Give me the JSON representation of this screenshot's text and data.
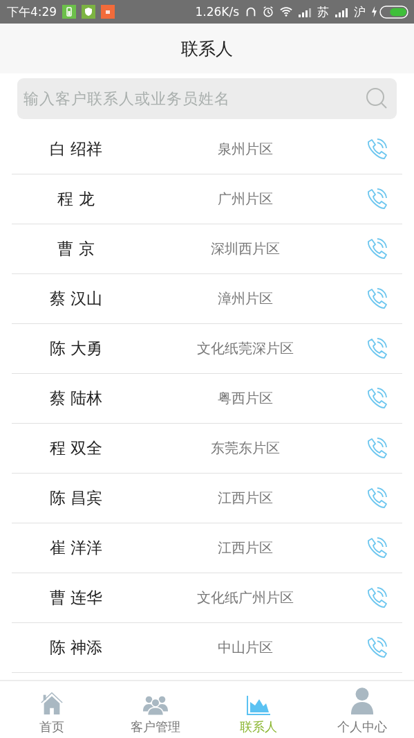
{
  "status_bar": {
    "time": "下午4:29",
    "speed": "1.26K/s",
    "sim_1": "苏",
    "sim_2": "沪"
  },
  "header": {
    "title": "联系人"
  },
  "search": {
    "placeholder": "输入客户联系人或业务员姓名"
  },
  "contacts": [
    {
      "name": "白 绍祥",
      "region": "泉州片区"
    },
    {
      "name": "程 龙",
      "region": "广州片区"
    },
    {
      "name": "曹 京",
      "region": "深圳西片区"
    },
    {
      "name": "蔡 汉山",
      "region": "漳州片区"
    },
    {
      "name": "陈 大勇",
      "region": "文化纸莞深片区"
    },
    {
      "name": "蔡 陆林",
      "region": "粤西片区"
    },
    {
      "name": "程 双全",
      "region": "东莞东片区"
    },
    {
      "name": "陈 昌宾",
      "region": "江西片区"
    },
    {
      "name": "崔 洋洋",
      "region": "江西片区"
    },
    {
      "name": "曹 连华",
      "region": "文化纸广州片区"
    },
    {
      "name": "陈 神添",
      "region": "中山片区"
    }
  ],
  "tab_bar": [
    {
      "kind": "home",
      "label": "首页",
      "selected": false
    },
    {
      "kind": "customers",
      "label": "客户管理",
      "selected": false
    },
    {
      "kind": "contacts",
      "label": "联系人",
      "selected": true
    },
    {
      "kind": "profile",
      "label": "个人中心",
      "selected": false
    }
  ]
}
